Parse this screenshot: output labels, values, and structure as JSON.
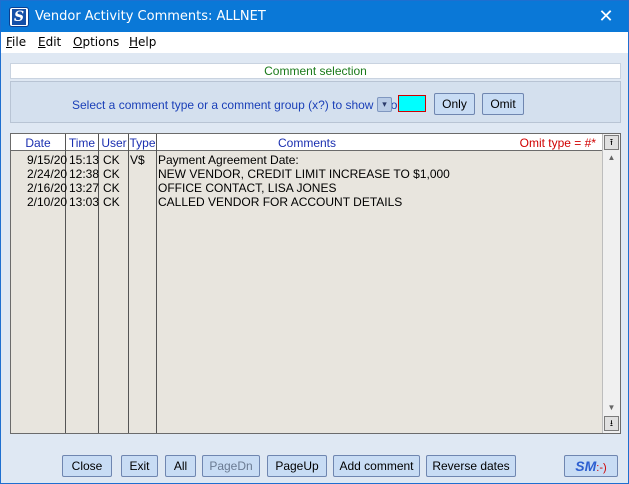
{
  "window": {
    "title": "Vendor Activity Comments:  ALLNET",
    "app_icon_letter": "S",
    "close_glyph": "✕"
  },
  "menu": [
    "File",
    "Edit",
    "Options",
    "Help"
  ],
  "selection": {
    "header": "Comment selection",
    "prompt": "Select a comment type or a comment group (x?) to show or omit",
    "dropdown_glyph": "▾",
    "only_label": "Only",
    "omit_label": "Omit",
    "color_swatch": "#00ffff"
  },
  "grid": {
    "columns": {
      "date": "Date",
      "time": "Time",
      "user": "User",
      "type": "Type",
      "comments": "Comments"
    },
    "omit_type": "Omit type  =  #*",
    "rows": [
      {
        "date": "9/15/20",
        "time": "15:13",
        "user": "CK",
        "type": "V$",
        "comment": "Payment Agreement Date:"
      },
      {
        "date": "2/24/20",
        "time": "12:38",
        "user": "CK",
        "type": "",
        "comment": "NEW VENDOR, CREDIT LIMIT INCREASE TO $1,000"
      },
      {
        "date": "2/16/20",
        "time": "13:27",
        "user": "CK",
        "type": "",
        "comment": "OFFICE CONTACT, LISA JONES"
      },
      {
        "date": "2/10/20",
        "time": "13:03",
        "user": "CK",
        "type": "",
        "comment": "CALLED VENDOR FOR ACCOUNT DETAILS"
      }
    ],
    "scroll_top_glyph": "⭱",
    "scroll_bottom_glyph": "⭳",
    "scroll_up_glyph": "▲",
    "scroll_down_glyph": "▼"
  },
  "buttons": {
    "close": "Close",
    "exit": "Exit",
    "all": "All",
    "pagedn": "PageDn",
    "pageup": "PageUp",
    "add_comment": "Add comment",
    "reverse_dates": "Reverse dates"
  },
  "logo": {
    "text": "SM",
    "smile": ":-)"
  }
}
